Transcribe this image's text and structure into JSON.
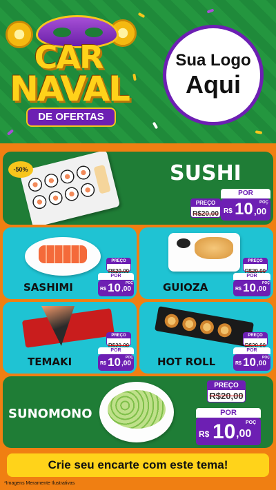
{
  "header": {
    "title_line1": "CAR",
    "title_line2": "NAVAL",
    "subtitle": "DE OFERTAS",
    "logo_line1": "Sua Logo",
    "logo_line2": "Aqui"
  },
  "featured": {
    "badge": "-50%",
    "name": "SUSHI",
    "old_label": "PREÇO",
    "old_price": "R$20,00",
    "new_label": "POR",
    "currency": "R$",
    "price_int": "10",
    "price_cents": ",00",
    "poc": "POÇ"
  },
  "items": [
    {
      "name": "SASHIMI",
      "old_label": "PREÇO",
      "old_price": "R$20,00",
      "new_label": "POR",
      "currency": "R$",
      "price_int": "10",
      "price_cents": ",00",
      "poc": "POÇ"
    },
    {
      "name": "GUIOZA",
      "old_label": "PREÇO",
      "old_price": "R$20,00",
      "new_label": "POR",
      "currency": "R$",
      "price_int": "10",
      "price_cents": ",00",
      "poc": "POÇ"
    },
    {
      "name": "TEMAKI",
      "old_label": "PREÇO",
      "old_price": "R$20,00",
      "new_label": "POR",
      "currency": "R$",
      "price_int": "10",
      "price_cents": ",00",
      "poc": "POÇ"
    },
    {
      "name": "HOT ROLL",
      "old_label": "PREÇO",
      "old_price": "R$20,00",
      "new_label": "POR",
      "currency": "R$",
      "price_int": "10",
      "price_cents": ",00",
      "poc": "POÇ"
    }
  ],
  "bottom_item": {
    "name": "SUNOMONO",
    "old_label": "PREÇO",
    "old_price": "R$20,00",
    "new_label": "POR",
    "currency": "R$",
    "price_int": "10",
    "price_cents": ",00",
    "poc": "POÇ"
  },
  "footer": {
    "cta": "Crie seu encarte com este tema!",
    "disclaimer": "*Imagens Meramente Ilustrativas"
  },
  "colors": {
    "purple": "#6d1fb3",
    "green": "#1f7d36",
    "teal": "#1fc3d3",
    "orange": "#f07f12",
    "yellow": "#ffd31a"
  }
}
